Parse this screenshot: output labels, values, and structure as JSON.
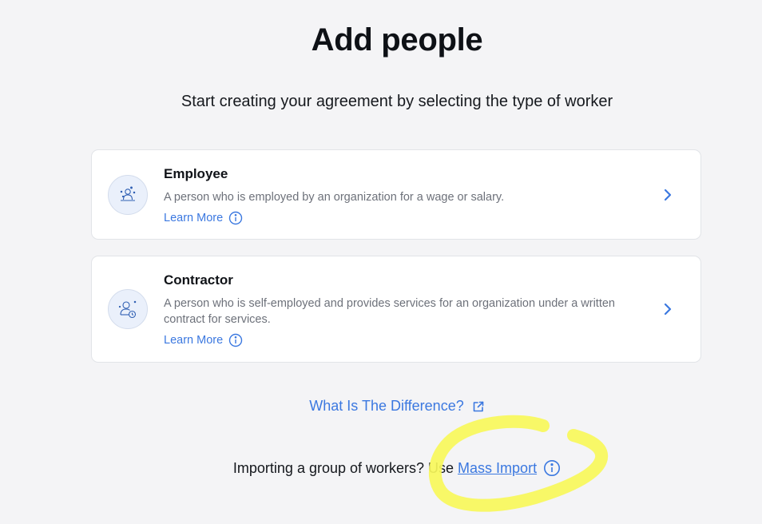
{
  "page": {
    "title": "Add people",
    "subtitle": "Start creating your agreement by selecting the type of worker"
  },
  "worker_types": [
    {
      "title": "Employee",
      "description": "A person who is employed by an organization for a wage or salary.",
      "learn_more": "Learn More",
      "icon": "employee-icon"
    },
    {
      "title": "Contractor",
      "description": "A person who is self-employed and provides services for an organization under a written contract for services.",
      "learn_more": "Learn More",
      "icon": "contractor-icon"
    }
  ],
  "difference_link": {
    "label": "What Is The Difference?",
    "icon": "external-link-icon"
  },
  "import": {
    "prompt": "Importing a group of workers? Use",
    "link_label": "Mass Import",
    "icon": "info-icon"
  },
  "colors": {
    "accent": "#3b78e0",
    "background": "#f4f4f6",
    "highlight": "#f7f75a"
  }
}
